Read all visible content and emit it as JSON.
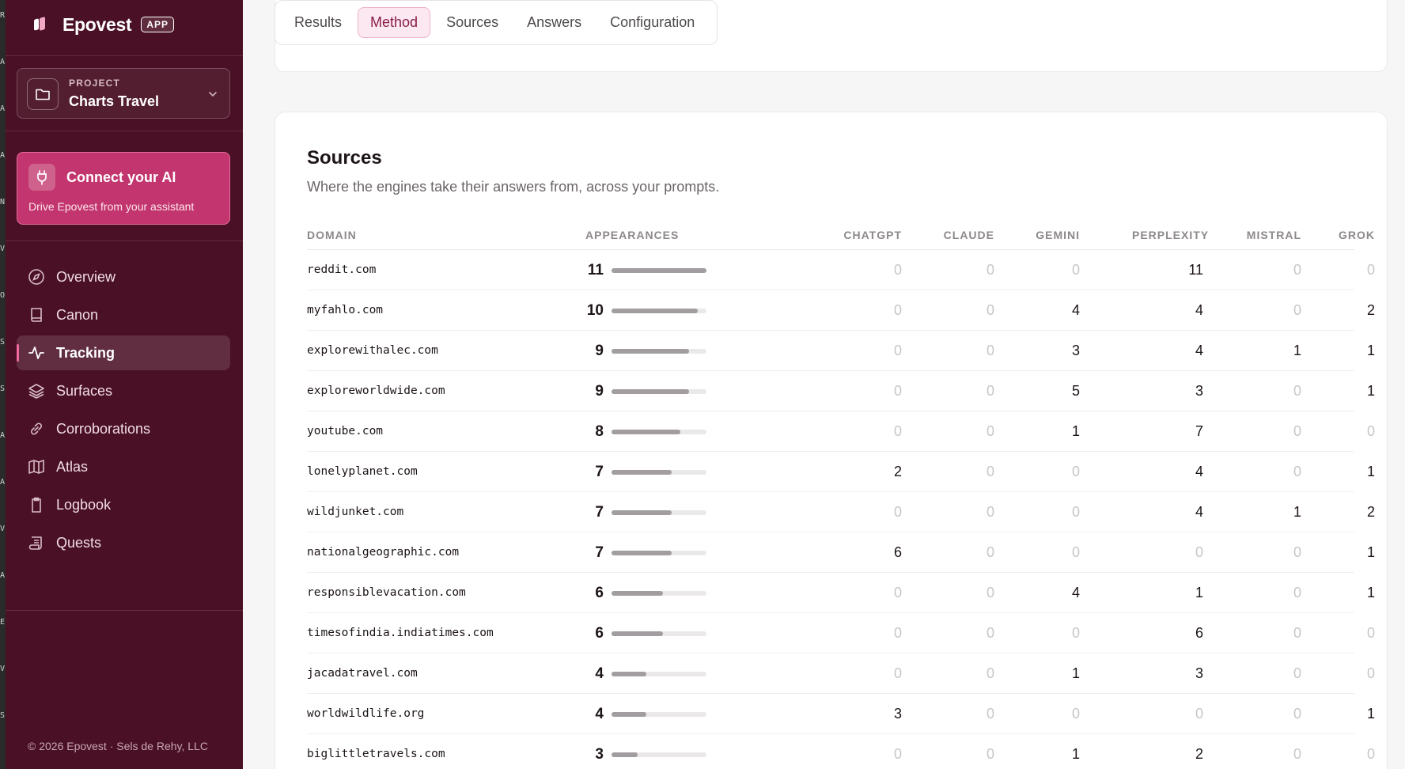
{
  "app": {
    "name": "Epovest",
    "badge": "APP"
  },
  "edge_strip_letters": [
    "R",
    "A",
    "A",
    "A",
    "N",
    "V",
    "O",
    "S",
    "S",
    "A",
    "A",
    "V",
    "A",
    "E",
    "V",
    "S"
  ],
  "project": {
    "kicker": "PROJECT",
    "name": "Charts Travel"
  },
  "connect": {
    "title": "Connect your AI",
    "subtitle": "Drive Epovest from your assistant"
  },
  "nav": [
    {
      "label": "Overview",
      "icon": "compass-icon",
      "active": false
    },
    {
      "label": "Canon",
      "icon": "book-icon",
      "active": false
    },
    {
      "label": "Tracking",
      "icon": "activity-icon",
      "active": true
    },
    {
      "label": "Surfaces",
      "icon": "layers-icon",
      "active": false
    },
    {
      "label": "Corroborations",
      "icon": "link-icon",
      "active": false
    },
    {
      "label": "Atlas",
      "icon": "map-icon",
      "active": false
    },
    {
      "label": "Logbook",
      "icon": "clipboard-icon",
      "active": false
    },
    {
      "label": "Quests",
      "icon": "scroll-icon",
      "active": false
    }
  ],
  "footer": "© 2026 Epovest · Sels de Rehy, LLC",
  "tabs": [
    {
      "label": "Results",
      "active": false
    },
    {
      "label": "Method",
      "active": true
    },
    {
      "label": "Sources",
      "active": false
    },
    {
      "label": "Answers",
      "active": false
    },
    {
      "label": "Configuration",
      "active": false
    }
  ],
  "sources": {
    "title": "Sources",
    "subtitle": "Where the engines take their answers from, across your prompts.",
    "columns": {
      "domain": "DOMAIN",
      "appearances": "APPEARANCES",
      "chatgpt": "CHATGPT",
      "claude": "CLAUDE",
      "gemini": "GEMINI",
      "perplexity": "PERPLEXITY",
      "mistral": "MISTRAL",
      "grok": "GROK"
    },
    "max_appearances": 11,
    "rows": [
      {
        "domain": "reddit.com",
        "appearances": 11,
        "chatgpt": 0,
        "claude": 0,
        "gemini": 0,
        "perplexity": 11,
        "mistral": 0,
        "grok": 0
      },
      {
        "domain": "myfahlo.com",
        "appearances": 10,
        "chatgpt": 0,
        "claude": 0,
        "gemini": 4,
        "perplexity": 4,
        "mistral": 0,
        "grok": 2
      },
      {
        "domain": "explorewithalec.com",
        "appearances": 9,
        "chatgpt": 0,
        "claude": 0,
        "gemini": 3,
        "perplexity": 4,
        "mistral": 1,
        "grok": 1
      },
      {
        "domain": "exploreworldwide.com",
        "appearances": 9,
        "chatgpt": 0,
        "claude": 0,
        "gemini": 5,
        "perplexity": 3,
        "mistral": 0,
        "grok": 1
      },
      {
        "domain": "youtube.com",
        "appearances": 8,
        "chatgpt": 0,
        "claude": 0,
        "gemini": 1,
        "perplexity": 7,
        "mistral": 0,
        "grok": 0
      },
      {
        "domain": "lonelyplanet.com",
        "appearances": 7,
        "chatgpt": 2,
        "claude": 0,
        "gemini": 0,
        "perplexity": 4,
        "mistral": 0,
        "grok": 1
      },
      {
        "domain": "wildjunket.com",
        "appearances": 7,
        "chatgpt": 0,
        "claude": 0,
        "gemini": 0,
        "perplexity": 4,
        "mistral": 1,
        "grok": 2
      },
      {
        "domain": "nationalgeographic.com",
        "appearances": 7,
        "chatgpt": 6,
        "claude": 0,
        "gemini": 0,
        "perplexity": 0,
        "mistral": 0,
        "grok": 1
      },
      {
        "domain": "responsiblevacation.com",
        "appearances": 6,
        "chatgpt": 0,
        "claude": 0,
        "gemini": 4,
        "perplexity": 1,
        "mistral": 0,
        "grok": 1
      },
      {
        "domain": "timesofindia.indiatimes.com",
        "appearances": 6,
        "chatgpt": 0,
        "claude": 0,
        "gemini": 0,
        "perplexity": 6,
        "mistral": 0,
        "grok": 0
      },
      {
        "domain": "jacadatravel.com",
        "appearances": 4,
        "chatgpt": 0,
        "claude": 0,
        "gemini": 1,
        "perplexity": 3,
        "mistral": 0,
        "grok": 0
      },
      {
        "domain": "worldwildlife.org",
        "appearances": 4,
        "chatgpt": 3,
        "claude": 0,
        "gemini": 0,
        "perplexity": 0,
        "mistral": 0,
        "grok": 1
      },
      {
        "domain": "biglittletravels.com",
        "appearances": 3,
        "chatgpt": 0,
        "claude": 0,
        "gemini": 1,
        "perplexity": 2,
        "mistral": 0,
        "grok": 0
      }
    ]
  },
  "colors": {
    "sidebar_bg": "#4a1025",
    "accent": "#c2356e",
    "tab_active_bg": "#fbe8f0",
    "tab_active_text": "#8a1d49"
  }
}
